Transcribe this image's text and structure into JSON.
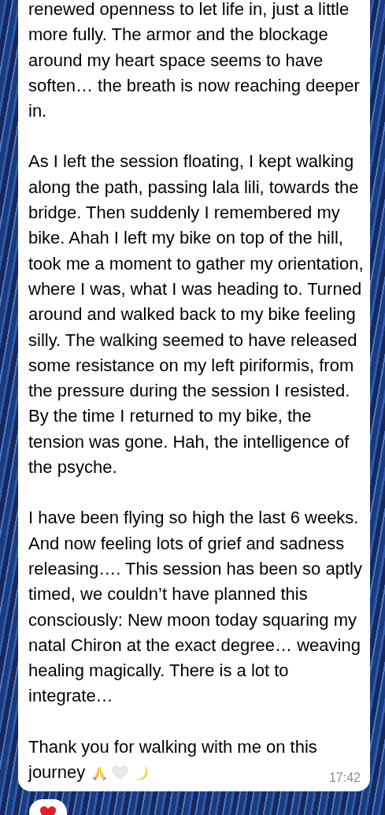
{
  "message": {
    "paragraphs": [
      "renewed openness to let life in, just a little more fully. The armor and the blockage around my heart space seems to have soften… the breath is now reaching deeper in.",
      "As I left the session floating, I kept walking along the path, passing lala lili, towards the bridge. Then suddenly I remembered my bike. Ahah I left my bike on top of the hill, took me a moment to gather my orientation, where I was, what I was heading to. Turned around and walked back to my bike feeling silly. The walking seemed to have released some resistance on my left piriformis, from the pressure during the session I resisted. By the time I returned to my bike, the tension was gone. Hah, the intelligence of the psyche.",
      "I have been flying so high the last 6 weeks. And now feeling lots of grief and sadness releasing…. This session has been so aptly timed, we couldn’t have planned this consciously: New moon today squaring my natal Chiron at the exact degree… weaving healing magically. There is a lot to integrate…"
    ],
    "closing_lines": [
      "Thank you for walking with me on this",
      "journey"
    ],
    "time": "17:42"
  }
}
